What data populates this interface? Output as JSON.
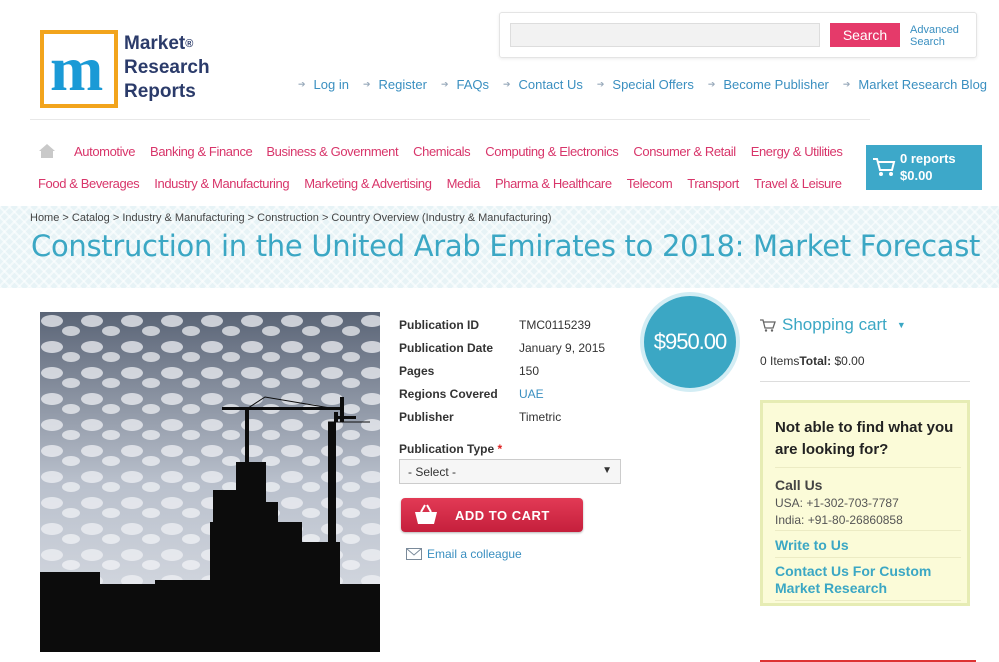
{
  "logo": {
    "line1": "Market",
    "line2": "Research",
    "line3": "Reports",
    "reg": "®"
  },
  "search": {
    "placeholder": "",
    "button_label": "Search",
    "advanced_line1": "Advanced",
    "advanced_line2": "Search"
  },
  "top_links": [
    "Log in",
    "Register",
    "FAQs",
    "Contact Us",
    "Special Offers",
    "Become Publisher",
    "Market Research Blog"
  ],
  "nav_row1": [
    "Automotive",
    "Banking & Finance",
    "Business & Government",
    "Chemicals",
    "Computing & Electronics",
    "Consumer & Retail",
    "Energy & Utilities"
  ],
  "nav_row2": [
    "Food & Beverages",
    "Industry & Manufacturing",
    "Marketing & Advertising",
    "Media",
    "Pharma & Healthcare",
    "Telecom",
    "Transport",
    "Travel & Leisure"
  ],
  "cart_badge": {
    "count": "0 reports",
    "total": "$0.00"
  },
  "breadcrumb": "Home > Catalog > Industry & Manufacturing > Construction > Country Overview (Industry & Manufacturing)",
  "title": "Construction in the United Arab Emirates to 2018: Market Forecast",
  "details": [
    {
      "label": "Publication ID",
      "value": "TMC0115239"
    },
    {
      "label": "Publication Date",
      "value": "January 9, 2015"
    },
    {
      "label": "Pages",
      "value": "150"
    },
    {
      "label": "Regions Covered",
      "value": "UAE"
    },
    {
      "label": "Publisher",
      "value": "Timetric"
    }
  ],
  "publication_type": {
    "label": "Publication Type",
    "required": "*",
    "selected": "- Select -"
  },
  "add_to_cart": "ADD TO CART",
  "email_colleague": "Email a colleague",
  "price": "$950.00",
  "shopping_cart": {
    "title": "Shopping cart",
    "items": "0 Items",
    "total_label": "Total:",
    "total_value": "$0.00"
  },
  "help": {
    "question": "Not able to find what you are looking for?",
    "call_title": "Call Us",
    "usa": "USA: +1-302-703-7787",
    "india": "India: +91-80-26860858",
    "write": "Write to Us",
    "custom": "Contact Us For Custom Market Research"
  },
  "colors": {
    "accent": "#3ba7c4",
    "nav": "#d8356a",
    "button": "#e53a6a"
  }
}
